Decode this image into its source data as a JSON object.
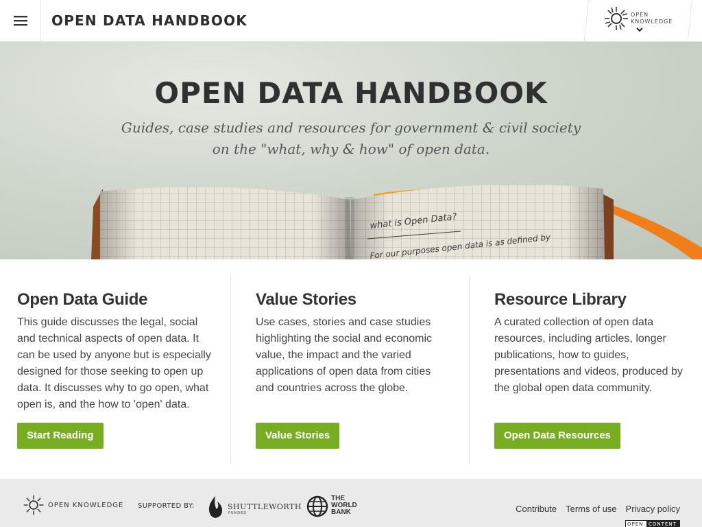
{
  "header": {
    "site_title": "OPEN DATA HANDBOOK",
    "org_logo_line1": "OPEN",
    "org_logo_line2": "KNOWLEDGE"
  },
  "hero": {
    "title": "OPEN DATA HANDBOOK",
    "subtitle_line1": "Guides, case studies and resources for government & civil society",
    "subtitle_line2": "on the \"what, why & how\" of open data.",
    "notebook_heading": "what is Open Data?",
    "notebook_line": "For our purposes open data is as defined by"
  },
  "columns": [
    {
      "title": "Open Data Guide",
      "text": "This guide discusses the legal, social and technical aspects of open data. It can be used by anyone but is especially designed for those seeking to open up data. It discusses why to go open, what open is, and the how to 'open' data.",
      "button": "Start Reading"
    },
    {
      "title": "Value Stories",
      "text": "Use cases, stories and case studies highlighting the social and economic value, the impact and the varied applications of open data from cities and countries across the globe.",
      "button": "Value Stories"
    },
    {
      "title": "Resource Library",
      "text": "A curated collection of open data resources, including articles, longer publications, how to guides, presentations and videos, produced by the global open data community.",
      "button": "Open Data Resources"
    }
  ],
  "footer": {
    "org_name": "OPEN KNOWLEDGE",
    "supported_by": "SUPPORTED BY:",
    "shuttleworth_name": "SHUTTLEWORTH",
    "shuttleworth_sub": "FUNDED",
    "worldbank_line1": "THE",
    "worldbank_line2": "WORLD",
    "worldbank_line3": "BANK",
    "links": [
      "Contribute",
      "Terms of use",
      "Privacy policy"
    ],
    "badge_left": "OPEN",
    "badge_right": "CONTENT"
  },
  "colors": {
    "accent_green": "#77ae21",
    "notebook_ribbon": "#f07e1a",
    "text_dark": "#333333"
  },
  "icons": [
    "menu-icon",
    "chevron-down-icon",
    "open-knowledge-logo-icon",
    "shuttleworth-flame-icon",
    "world-bank-globe-icon"
  ]
}
